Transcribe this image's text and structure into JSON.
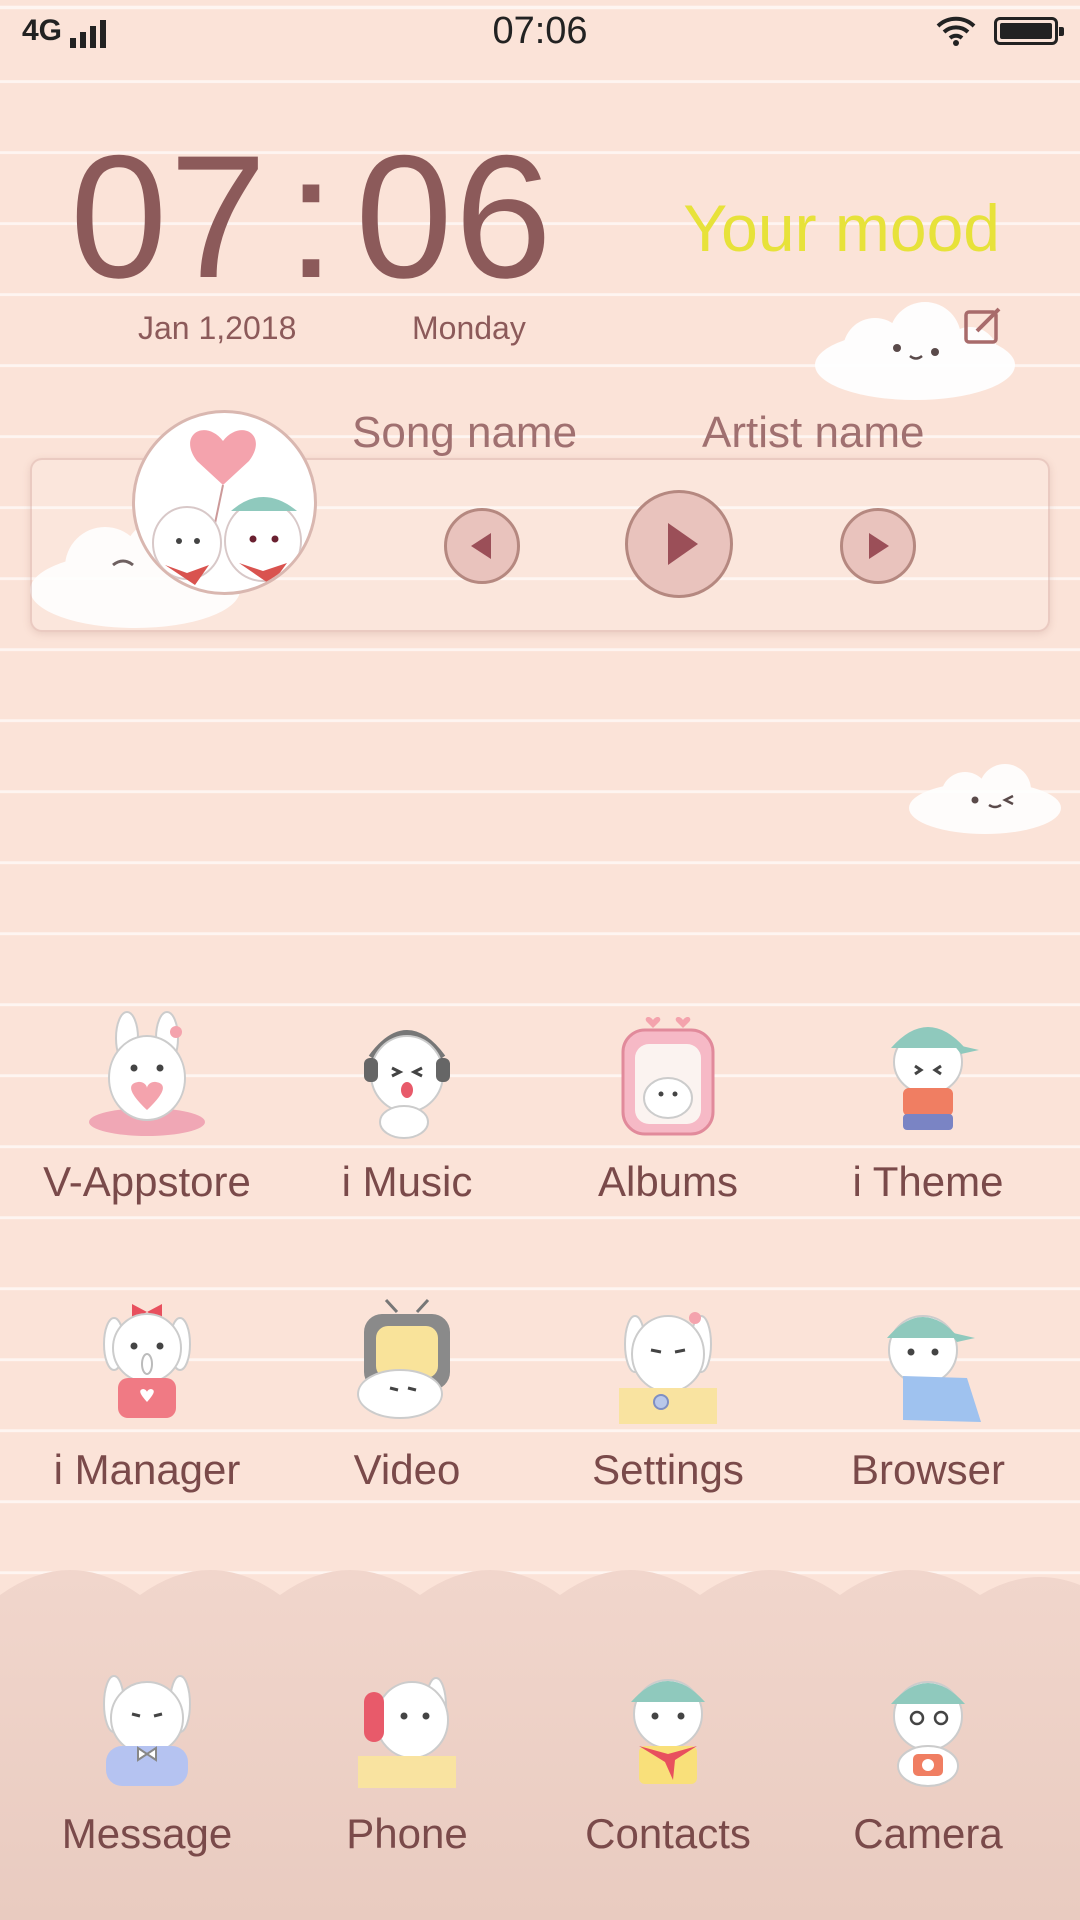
{
  "status_bar": {
    "network": "4G",
    "time": "07:06"
  },
  "clock_widget": {
    "hours": "07",
    "separator": ":",
    "minutes": "06",
    "date": "Jan 1,2018",
    "weekday": "Monday",
    "mood": "Your mood"
  },
  "music_widget": {
    "song": "Song name",
    "artist": "Artist name"
  },
  "apps": [
    {
      "label": "V-Appstore",
      "icon": "bunny-heart-icon"
    },
    {
      "label": "i Music",
      "icon": "bunny-headphones-icon"
    },
    {
      "label": "Albums",
      "icon": "bunny-photo-frame-icon"
    },
    {
      "label": "i Theme",
      "icon": "bunny-cap-icon"
    },
    {
      "label": "i Manager",
      "icon": "bunny-bow-icon"
    },
    {
      "label": "Video",
      "icon": "bunny-tv-icon"
    },
    {
      "label": "Settings",
      "icon": "bunny-desk-icon"
    },
    {
      "label": "Browser",
      "icon": "bunny-cape-icon"
    }
  ],
  "dock": [
    {
      "label": "Message",
      "icon": "bunny-pillow-icon"
    },
    {
      "label": "Phone",
      "icon": "bunny-phone-icon"
    },
    {
      "label": "Contacts",
      "icon": "bunny-scarf-icon"
    },
    {
      "label": "Camera",
      "icon": "bunny-camera-icon"
    }
  ],
  "colors": {
    "background": "#fbe3d8",
    "text": "#8c5a5a",
    "mood_accent": "#e7e23a",
    "label": "#7a4a4a"
  }
}
